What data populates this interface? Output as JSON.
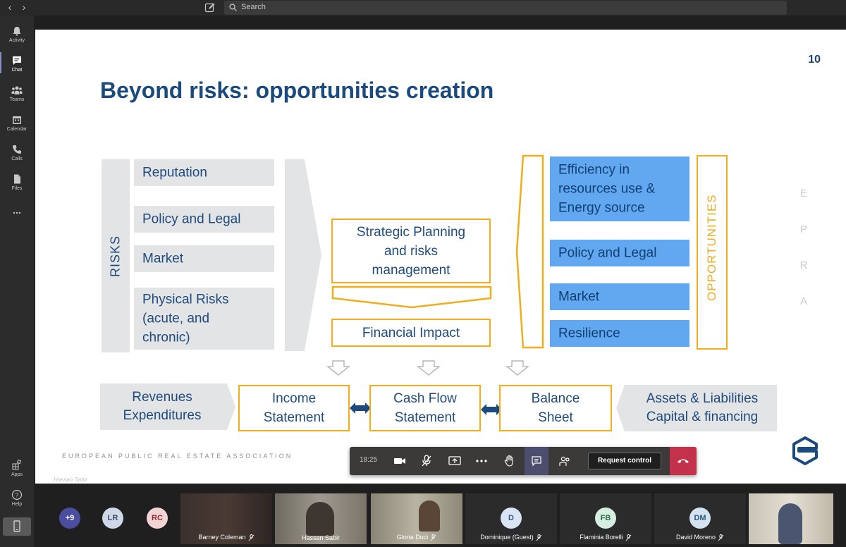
{
  "search": {
    "placeholder": "Search"
  },
  "rail": {
    "activity": "Activity",
    "chat": "Chat",
    "teams": "Teams",
    "calendar": "Calendar",
    "calls": "Calls",
    "files": "Files",
    "more": "...",
    "apps": "Apps",
    "help": "Help"
  },
  "slide": {
    "number": "10",
    "title": "Beyond risks: opportunities creation",
    "risks_label": "RISKS",
    "opportunities_label": "OPPORTUNITIES",
    "risks": [
      "Reputation",
      "Policy and Legal",
      "Market",
      "Physical Risks (acute, and chronic)"
    ],
    "risk_lines": {
      "physical_1": "Physical Risks",
      "physical_2": "(acute, and",
      "physical_3": "chronic)"
    },
    "strategic_1": "Strategic Planning",
    "strategic_2": "and risks",
    "strategic_3": "management",
    "financial_impact": "Financial Impact",
    "opportunities": {
      "efficiency_1": "Efficiency in",
      "efficiency_2": "resources use &",
      "efficiency_3": "Energy source",
      "policy": "Policy and Legal",
      "market": "Market",
      "resilience": "Resilience"
    },
    "epra": [
      "E",
      "P",
      "R",
      "A"
    ],
    "bottom": {
      "rev_1": "Revenues",
      "rev_2": "Expenditures",
      "income_1": "Income",
      "income_2": "Statement",
      "cash_1": "Cash Flow",
      "cash_2": "Statement",
      "balance_1": "Balance",
      "balance_2": "Sheet",
      "assets_1": "Assets & Liabilities",
      "assets_2": "Capital & financing"
    },
    "footer": "EUROPEAN PUBLIC REAL ESTATE ASSOCIATION"
  },
  "controls": {
    "timer": "18:25",
    "request_control": "Request control"
  },
  "presenter": "Hassan Sabir",
  "participants": {
    "overflow": "+9",
    "lr": "LR",
    "rc": "RC",
    "barney": "Barney Coleman",
    "hassan": "Hassan Sabir",
    "gloria": "Gloria Duci",
    "dominique_initial": "D",
    "dominique": "Dominique (Guest)",
    "flaminia_initial": "FB",
    "flaminia": "Flaminia Borelli",
    "david_initial": "DM",
    "david": "David Moreno"
  },
  "colors": {
    "slide_blue": "#1f4b7d",
    "accent_orange": "#f0ad1d",
    "opp_blue": "#61a8f0",
    "hangup": "#c4314b"
  }
}
